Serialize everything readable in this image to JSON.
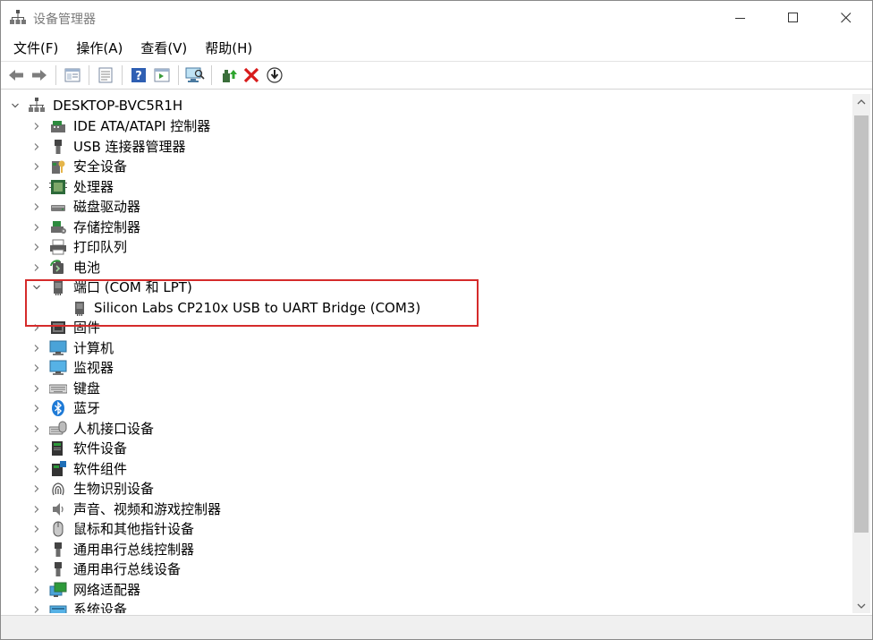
{
  "window": {
    "title": "设备管理器"
  },
  "menu": [
    "文件(F)",
    "操作(A)",
    "查看(V)",
    "帮助(H)"
  ],
  "toolbar": {
    "icons": [
      "back-icon",
      "forward-icon",
      "console-tree-icon",
      "properties-icon",
      "help-icon",
      "action-pane-icon",
      "scan-hardware-icon",
      "update-driver-icon",
      "uninstall-icon",
      "disable-icon"
    ]
  },
  "tree": {
    "root": "DESKTOP-BVC5R1H",
    "categories": [
      {
        "label": "IDE ATA/ATAPI 控制器",
        "icon": "ide-controller-icon"
      },
      {
        "label": "USB 连接器管理器",
        "icon": "usb-connector-icon"
      },
      {
        "label": "安全设备",
        "icon": "security-device-icon"
      },
      {
        "label": "处理器",
        "icon": "processor-icon"
      },
      {
        "label": "磁盘驱动器",
        "icon": "disk-drive-icon"
      },
      {
        "label": "存储控制器",
        "icon": "storage-controller-icon"
      },
      {
        "label": "打印队列",
        "icon": "printer-icon"
      },
      {
        "label": "电池",
        "icon": "battery-icon"
      },
      {
        "label": "端口 (COM 和 LPT)",
        "icon": "port-icon",
        "expanded": true
      },
      {
        "label": "Silicon Labs CP210x USB to UART Bridge (COM3)",
        "icon": "port-device-icon",
        "child": true
      },
      {
        "label": "固件",
        "icon": "firmware-icon"
      },
      {
        "label": "计算机",
        "icon": "computer-icon"
      },
      {
        "label": "监视器",
        "icon": "monitor-icon"
      },
      {
        "label": "键盘",
        "icon": "keyboard-icon"
      },
      {
        "label": "蓝牙",
        "icon": "bluetooth-icon"
      },
      {
        "label": "人机接口设备",
        "icon": "hid-icon"
      },
      {
        "label": "软件设备",
        "icon": "software-device-icon"
      },
      {
        "label": "软件组件",
        "icon": "software-component-icon"
      },
      {
        "label": "生物识别设备",
        "icon": "biometric-icon"
      },
      {
        "label": "声音、视频和游戏控制器",
        "icon": "sound-icon"
      },
      {
        "label": "鼠标和其他指针设备",
        "icon": "mouse-icon"
      },
      {
        "label": "通用串行总线控制器",
        "icon": "usb-controller-icon"
      },
      {
        "label": "通用串行总线设备",
        "icon": "usb-device-icon"
      },
      {
        "label": "网络适配器",
        "icon": "network-adapter-icon"
      },
      {
        "label": "系统设备",
        "icon": "system-device-icon"
      }
    ]
  },
  "colors": {
    "highlight_border": "#d52b2b",
    "scrollbar_thumb": "#c2c2c2"
  }
}
